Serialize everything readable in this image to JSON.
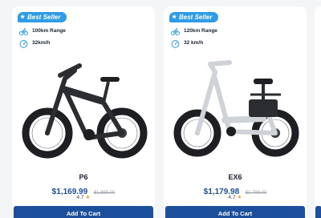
{
  "products": [
    {
      "badge": "Best Seller",
      "spec_range": "100km Range",
      "spec_speed": "32km/h",
      "name": "P6",
      "price": "$1,169.99",
      "old_price": "$1,899.00",
      "rating": "4.7",
      "cart_label": "Add To Cart",
      "frame_color": "#2b2d31"
    },
    {
      "badge": "Best Seller",
      "spec_range": "120km Range",
      "spec_speed": "32 km/h",
      "name": "EX6",
      "price": "$1,179.98",
      "old_price": "$1,799.00",
      "rating": "4.7",
      "cart_label": "Add To Cart",
      "frame_color": "#e6e8eb"
    }
  ],
  "colors": {
    "badge": "#2e9de6",
    "button": "#1c4f9c",
    "price": "#1c4f9c",
    "star": "#f2a93b"
  },
  "icons": [
    "star-icon",
    "bicycle-icon",
    "speedometer-icon"
  ]
}
